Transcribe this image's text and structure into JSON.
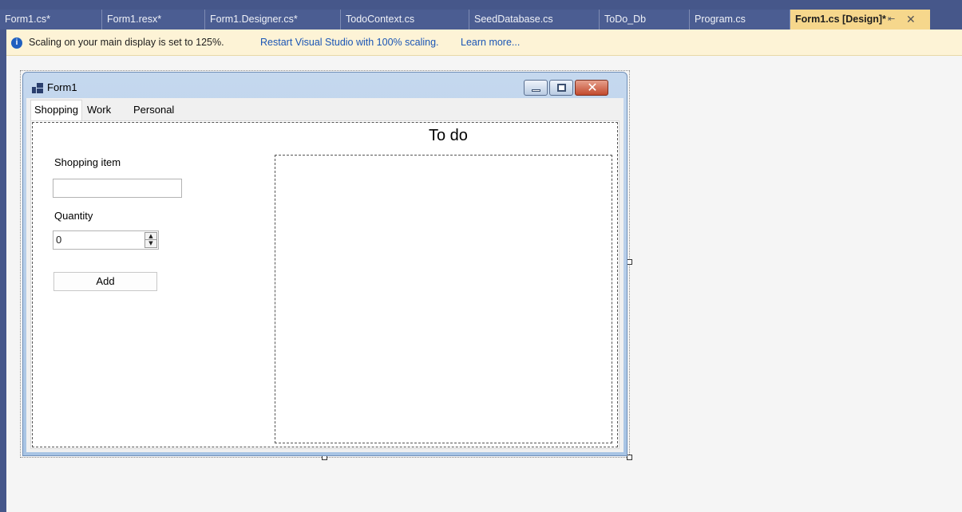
{
  "tabs": [
    {
      "label": "Form1.cs*",
      "active": false
    },
    {
      "label": "Form1.resx*",
      "active": false
    },
    {
      "label": "Form1.Designer.cs*",
      "active": false
    },
    {
      "label": "TodoContext.cs",
      "active": false
    },
    {
      "label": "SeedDatabase.cs",
      "active": false
    },
    {
      "label": "ToDo_Db",
      "active": false
    },
    {
      "label": "Program.cs",
      "active": false
    },
    {
      "label": "Form1.cs [Design]*",
      "active": true
    }
  ],
  "tab_icons": {
    "pin": "pin-icon",
    "close": "close-icon"
  },
  "infobar": {
    "icon": "info-icon",
    "message": "Scaling on your main display is set to 125%.",
    "restart_link": "Restart Visual Studio with 100% scaling.",
    "learn_link": "Learn more..."
  },
  "form": {
    "title": "Form1",
    "tabs": [
      "Shopping",
      "Work",
      "Personal"
    ],
    "shopping_item_label": "Shopping item",
    "shopping_item_value": "",
    "quantity_label": "Quantity",
    "quantity_value": "0",
    "add_button": "Add",
    "todo_label": "To do"
  },
  "colors": {
    "tabstrip": "#46578a",
    "active_tab": "#f6d78c",
    "infobar": "#fdf3d6",
    "link": "#1a55b5"
  }
}
